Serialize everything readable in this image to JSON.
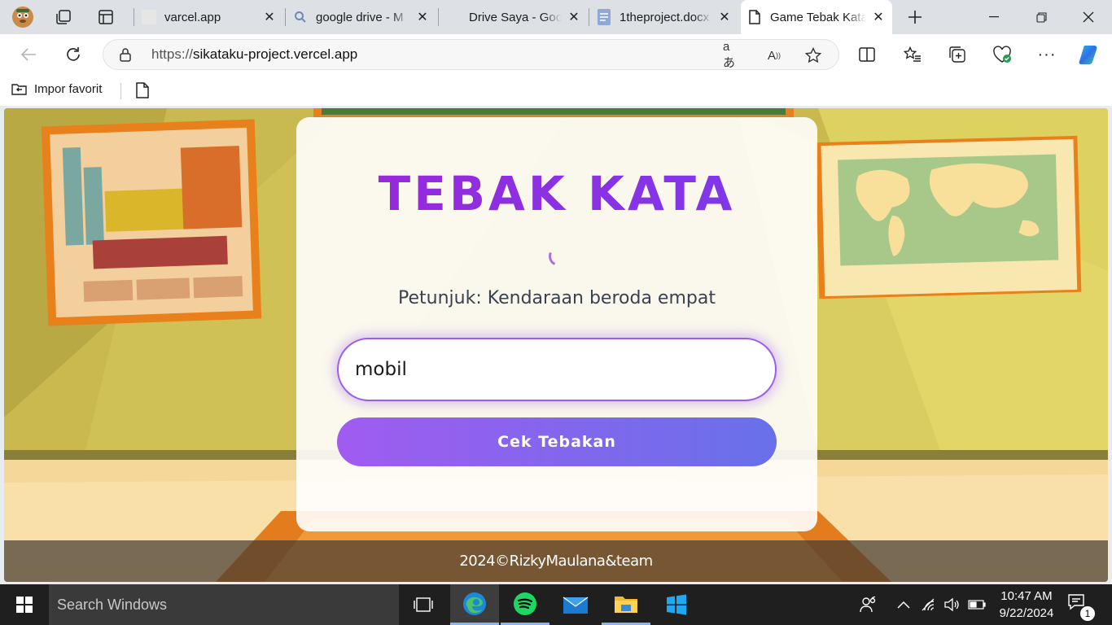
{
  "browser": {
    "tabs": [
      {
        "title": "varcel.app",
        "icon": "blank-page-icon"
      },
      {
        "title": "google drive - M",
        "icon": "search-icon"
      },
      {
        "title": "Drive Saya - Goo",
        "icon": "google-drive-icon"
      },
      {
        "title": "1theproject.docx",
        "icon": "docs-icon"
      },
      {
        "title": "Game Tebak Kata",
        "icon": "page-icon"
      }
    ],
    "url_prefix": "https://",
    "url_host": "sikataku-project.vercel.app",
    "favorites": {
      "import_label": "Impor favorit"
    }
  },
  "page": {
    "title": "TEBAK KATA",
    "hint": "Petunjuk: Kendaraan beroda empat",
    "guess_value": "mobil",
    "button_label": "Cek Tebakan",
    "footer": "2024©RizkyMaulana&team",
    "accent": "#8a2be2"
  },
  "taskbar": {
    "search_placeholder": "Search Windows",
    "time": "10:47 AM",
    "date": "9/22/2024",
    "notification_count": "1"
  }
}
